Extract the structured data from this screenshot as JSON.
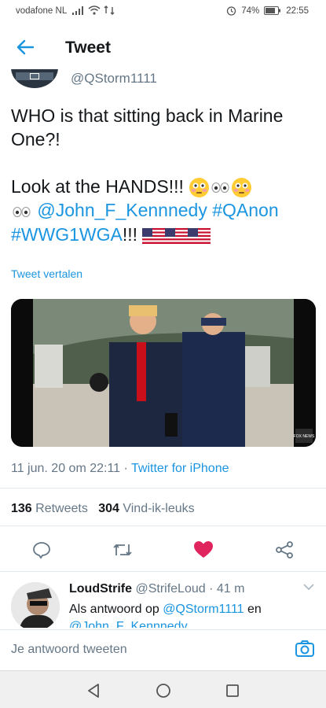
{
  "status_bar": {
    "carrier": "vodafone NL",
    "battery": "74%",
    "time": "22:55"
  },
  "header": {
    "title": "Tweet"
  },
  "tweet": {
    "handle": "@QStorm1111",
    "text_line1": "WHO is that sitting back in Marine One?!",
    "text_line2a": "Look at the HANDS!!! ",
    "mention": "@John_F_Kennnedy",
    "hashtag1": "#QAnon",
    "hashtag2": "#WWG1WGA",
    "exclaim": "!!! ",
    "translate": "Tweet vertalen",
    "date": "11 jun. 20 om 22:11 · ",
    "source": "Twitter for iPhone",
    "retweets": "136",
    "retweets_label": "Retweets",
    "likes": "304",
    "likes_label": "Vind-ik-leuks",
    "media_badge": "FOX NEWS"
  },
  "reply": {
    "name": "LoudStrife",
    "handle_time": "@StrifeLoud · 41 m",
    "prefix": "Als antwoord op ",
    "to1": "@QStorm1111",
    "and": " en",
    "to2": "@John_F_Kennnedy"
  },
  "compose": {
    "placeholder": "Je antwoord tweeten"
  },
  "colors": {
    "accent": "#1b95e0",
    "like": "#e0245e",
    "text": "#14171a",
    "muted": "#657786"
  }
}
